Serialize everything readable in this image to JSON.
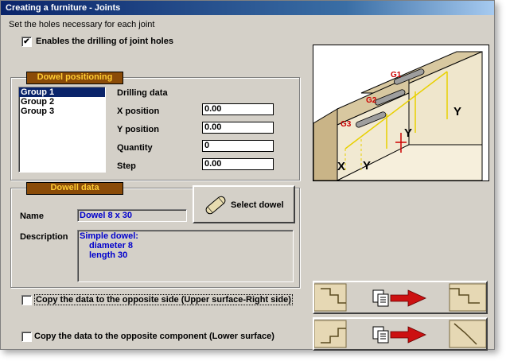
{
  "window": {
    "title": "Creating a furniture - Joints"
  },
  "intro": "Set the holes necessary for each joint",
  "enable_drilling": {
    "label": "Enables the drilling of joint holes",
    "checked": true,
    "mark": "✔"
  },
  "dowel_positioning": {
    "legend": "Dowel positioning",
    "groups": [
      "Group 1",
      "Group 2",
      "Group 3"
    ],
    "selected_index": 0,
    "drilling_data_label": "Drilling data",
    "fields": {
      "x_position": {
        "label": "X position",
        "value": "0.00"
      },
      "y_position": {
        "label": "Y position",
        "value": "0.00"
      },
      "quantity": {
        "label": "Quantity",
        "value": "0"
      },
      "step": {
        "label": "Step",
        "value": "0.00"
      }
    }
  },
  "dowel_data": {
    "legend": "Dowell data",
    "select_button_label": "Select dowel",
    "name_label": "Name",
    "name_value": "Dowel 8 x 30",
    "description_label": "Description",
    "description_lines": [
      "Simple dowel:",
      "diameter 8",
      "length 30"
    ]
  },
  "copy_opposite_side": {
    "label": "Copy the data to the opposite side (Upper surface-Right side)",
    "checked": false
  },
  "copy_opposite_component": {
    "label": "Copy the data to the opposite component (Lower surface)",
    "checked": false
  },
  "diagram": {
    "labels": [
      "G1",
      "G2",
      "G3",
      "X",
      "Y",
      "Y",
      "Y"
    ]
  },
  "colors": {
    "title_bar": "#0a246a",
    "legend_bg": "#8a4b08",
    "legend_text": "#ffcc33",
    "value_text": "#0000cc"
  }
}
